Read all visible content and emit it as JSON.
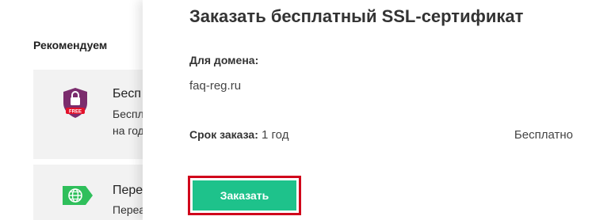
{
  "background": {
    "recommend_title": "Рекомендуем",
    "cards": [
      {
        "icon": "ssl-shield-free-icon",
        "title": "Бесп",
        "text": "Бесплатно на год!",
        "badge": "FREE"
      },
      {
        "icon": "globe-tag-icon",
        "title": "Пере",
        "text": "Переа"
      }
    ]
  },
  "modal": {
    "title": "Заказать бесплатный SSL-сертификат",
    "domain_label": "Для домена:",
    "domain_value": "faq-reg.ru",
    "term_label": "Срок заказа:",
    "term_value": "1 год",
    "price": "Бесплатно",
    "order_button": "Заказать"
  },
  "colors": {
    "accent_green": "#1ec28b",
    "highlight_red": "#d0021b",
    "shield_purple": "#7b2c6d",
    "globe_green": "#2fbf5b"
  }
}
